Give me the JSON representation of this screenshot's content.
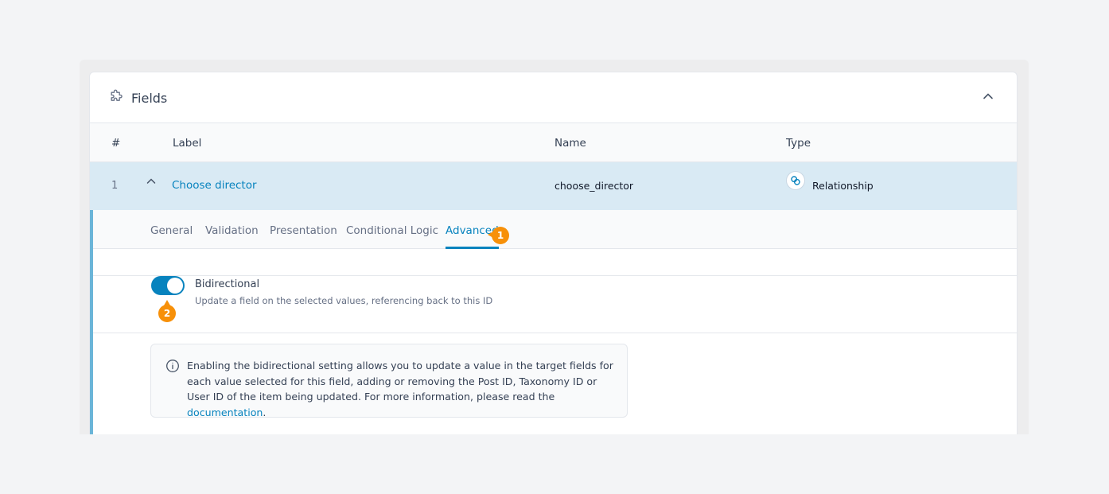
{
  "panel": {
    "title": "Fields"
  },
  "table": {
    "headers": [
      "#",
      "Label",
      "Name",
      "Type"
    ]
  },
  "field": {
    "number": "1",
    "label": "Choose director",
    "name": "choose_director",
    "type": "Relationship"
  },
  "tabs": [
    {
      "label": "General",
      "active": false
    },
    {
      "label": "Validation",
      "active": false
    },
    {
      "label": "Presentation",
      "active": false
    },
    {
      "label": "Conditional Logic",
      "active": false
    },
    {
      "label": "Advanced",
      "active": true
    }
  ],
  "setting": {
    "label": "Bidirectional",
    "description": "Update a field on the selected values, referencing back to this ID",
    "enabled": true
  },
  "info": {
    "text": "Enabling the bidirectional setting allows you to update a value in the target fields for each value selected for this field, adding or removing the Post ID, Taxonomy ID or User ID of the item being updated. For more information, please read the",
    "link_text": "documentation",
    "suffix": "."
  },
  "annotations": {
    "badge1": "1",
    "badge2": "2"
  },
  "colors": {
    "accent": "#0783be",
    "row_highlight": "#d9eaf4",
    "badge": "#f79009",
    "settings_border": "#6bb5d8"
  }
}
